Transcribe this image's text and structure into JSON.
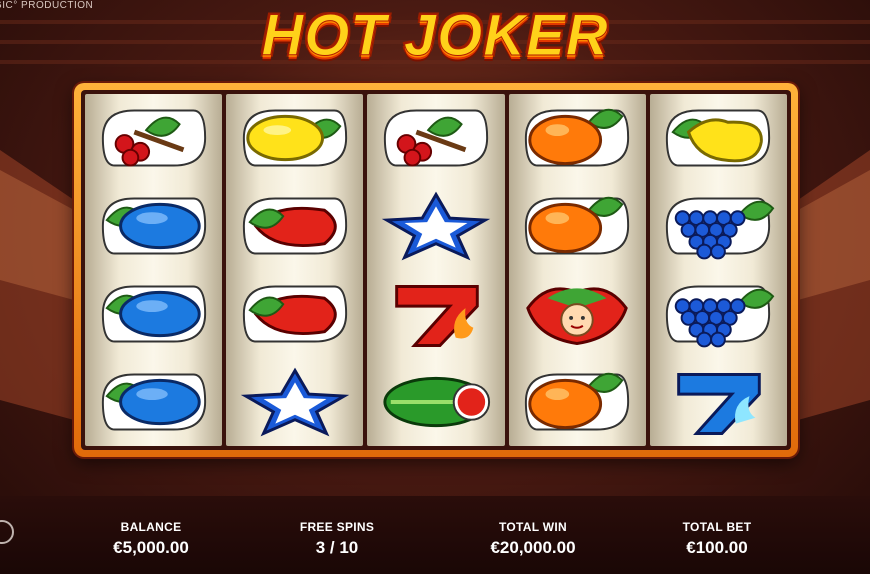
{
  "provider_text": "GIC° PRODUCTION",
  "game_title": "HOT JOKER",
  "reels": [
    [
      "cherries-icon",
      "plum-icon",
      "plum-icon",
      "plum-icon"
    ],
    [
      "lemon-icon",
      "strawberry-icon",
      "strawberry-icon",
      "star-icon"
    ],
    [
      "cherries-icon",
      "star-icon",
      "seven-fire-icon",
      "watermelon-icon"
    ],
    [
      "orange-icon",
      "orange-icon",
      "joker-icon",
      "orange-icon"
    ],
    [
      "pear-icon",
      "grapes-icon",
      "grapes-icon",
      "seven-water-icon"
    ]
  ],
  "stats": {
    "balance_label": "BALANCE",
    "balance_value": "€5,000.00",
    "free_spins_label": "FREE SPINS",
    "free_spins_value": "3 / 10",
    "total_win_label": "TOTAL WIN",
    "total_win_value": "€20,000.00",
    "total_bet_label": "TOTAL BET",
    "total_bet_value": "€100.00"
  },
  "colors": {
    "frame": "#f08a14",
    "title": "#ffd21a",
    "background": "#4a1a12"
  }
}
